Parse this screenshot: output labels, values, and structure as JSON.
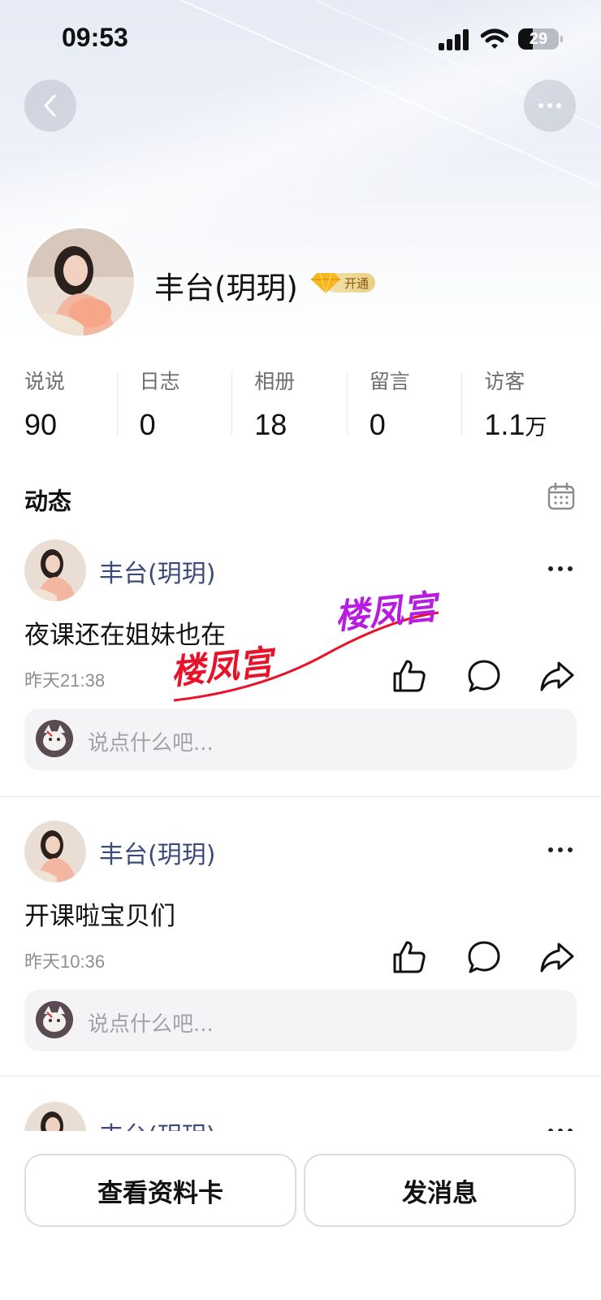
{
  "status_bar": {
    "time": "09:53",
    "battery": "29"
  },
  "profile": {
    "name": "丰台(玥玥)",
    "vip_label": "开通",
    "stats": [
      {
        "label": "说说",
        "value": "90",
        "unit": ""
      },
      {
        "label": "日志",
        "value": "0",
        "unit": ""
      },
      {
        "label": "相册",
        "value": "18",
        "unit": ""
      },
      {
        "label": "留言",
        "value": "0",
        "unit": ""
      },
      {
        "label": "访客",
        "value": "1.1",
        "unit": "万"
      }
    ]
  },
  "feed": {
    "title": "动态",
    "posts": [
      {
        "author": "丰台(玥玥)",
        "text": "夜课还在姐妹也在",
        "time": "昨天21:38",
        "comment_placeholder": "说点什么吧..."
      },
      {
        "author": "丰台(玥玥)",
        "text": "开课啦宝贝们",
        "time": "昨天10:36",
        "comment_placeholder": "说点什么吧..."
      },
      {
        "author": "丰台(玥玥)"
      }
    ]
  },
  "watermark": {
    "text_1": "楼凤宫",
    "text_2": "楼凤宫",
    "color_1": "#e8122a",
    "color_2": "#b81ce0"
  },
  "bottom_bar": {
    "profile_card_label": "查看资料卡",
    "message_label": "发消息"
  },
  "colors": {
    "author": "#3b4a78",
    "vip_gold": "#e9cf86"
  }
}
